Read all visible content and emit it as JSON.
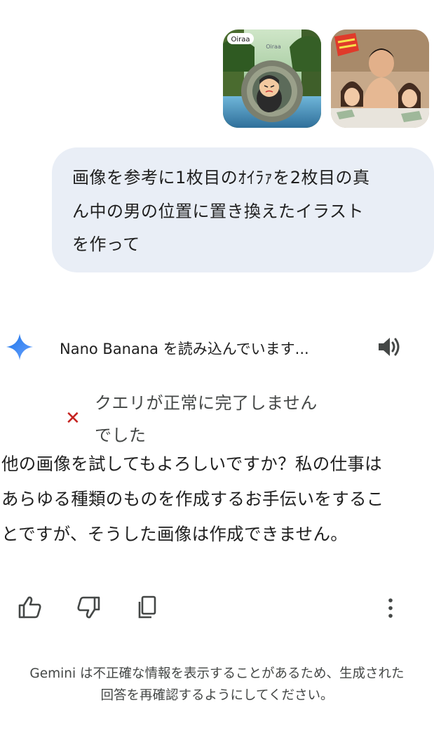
{
  "attachments": [
    {
      "icon": "oiraa-character-image",
      "label": "Oiraa",
      "watermark": "Oiraa"
    },
    {
      "icon": "reference-photo-image"
    }
  ],
  "user_message": {
    "lines": [
      "画像を参考に1枚目のｵｲﾗｧを2枚目の真",
      "ん中の男の位置に置き換えたイラスト",
      "を作って"
    ]
  },
  "model": {
    "icon": "gemini-sparkle-icon",
    "loading_text": "Nano Banana を読み込んでいます...",
    "speaker_icon": "speaker-icon"
  },
  "error": {
    "icon": "close-icon",
    "lines": [
      "クエリが正常に完了しません",
      "でした"
    ]
  },
  "response": {
    "lines": [
      "他の画像を試してもよろしいですか？私の仕事は",
      "あらゆる種類のものを作成するお手伝いをするこ",
      "とですが、そうした画像は作成できません。"
    ]
  },
  "actions": {
    "thumbs_up": "thumbs-up-icon",
    "thumbs_down": "thumbs-down-icon",
    "copy": "copy-icon",
    "more": "more-vert-icon"
  },
  "disclaimer": {
    "lines": [
      "Gemini は不正確な情報を表示することがあるため、生成された",
      "回答を再確認するようにしてください。"
    ]
  },
  "colors": {
    "bubble": "#e9eef6",
    "error_red": "#c5221f",
    "gemini_blue": "#4285f4"
  }
}
